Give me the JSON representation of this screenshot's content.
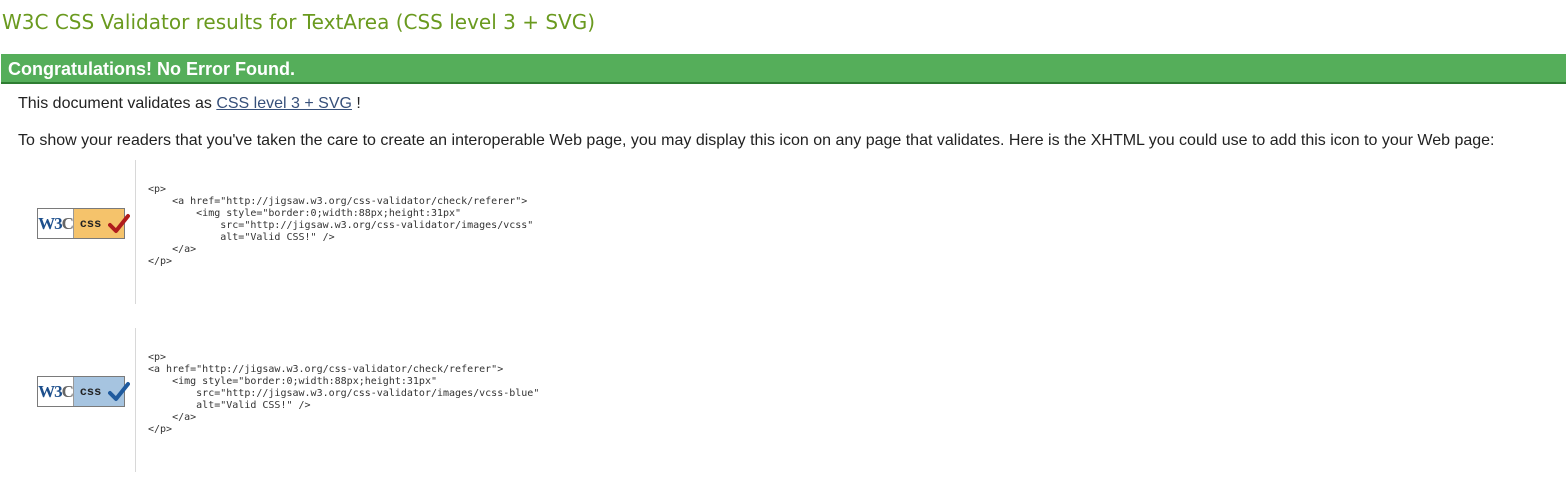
{
  "page": {
    "title": "W3C CSS Validator results for TextArea (CSS level 3 + SVG)"
  },
  "banner": {
    "text": "Congratulations! No Error Found.",
    "color": "#55ae5a"
  },
  "validates": {
    "prefix": "This document validates as ",
    "link_text": "CSS level 3 + SVG",
    "suffix": " !"
  },
  "info": {
    "text": "To show your readers that you've taken the care to create an interoperable Web page, you may display this icon on any page that validates. Here is the XHTML you could use to add this icon to your Web page:"
  },
  "badges": [
    {
      "icon": "valid-css-gold-badge-icon",
      "w3c_left": "W3",
      "w3c_three": "C",
      "css_label": "css",
      "bg_color": "#f5c36b",
      "check_color": "#b01c1c",
      "code": "<p>\n    <a href=\"http://jigsaw.w3.org/css-validator/check/referer\">\n        <img style=\"border:0;width:88px;height:31px\"\n            src=\"http://jigsaw.w3.org/css-validator/images/vcss\"\n            alt=\"Valid CSS!\" />\n    </a>\n</p>"
    },
    {
      "icon": "valid-css-blue-badge-icon",
      "w3c_left": "W3",
      "w3c_three": "C",
      "css_label": "css",
      "bg_color": "#a6c4e0",
      "check_color": "#1f5a9e",
      "code": "<p>\n<a href=\"http://jigsaw.w3.org/css-validator/check/referer\">\n    <img style=\"border:0;width:88px;height:31px\"\n        src=\"http://jigsaw.w3.org/css-validator/images/vcss-blue\"\n        alt=\"Valid CSS!\" />\n    </a>\n</p>"
    }
  ]
}
